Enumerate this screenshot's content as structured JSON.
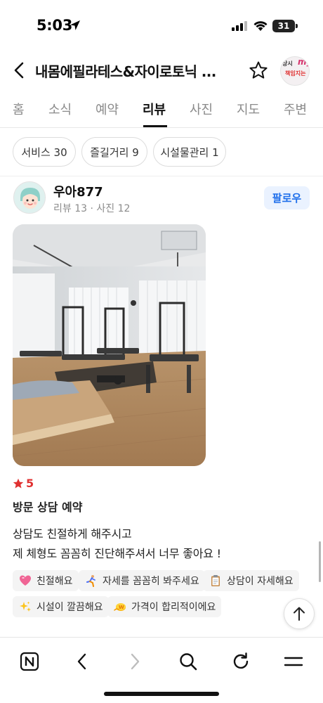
{
  "status_bar": {
    "time": "5:03",
    "battery": "31"
  },
  "header": {
    "title": "내몸에필라테스&자이로토닉 ...",
    "thumb_text_a": "상시",
    "thumb_text_b": "my",
    "thumb_text_c": "책임지는"
  },
  "tabs": [
    {
      "label": "홈"
    },
    {
      "label": "소식"
    },
    {
      "label": "예약"
    },
    {
      "label": "리뷰"
    },
    {
      "label": "사진"
    },
    {
      "label": "지도"
    },
    {
      "label": "주변"
    }
  ],
  "filters": [
    {
      "label": "서비스 30"
    },
    {
      "label": "즐길거리 9"
    },
    {
      "label": "시설물관리 1"
    }
  ],
  "review": {
    "author": "우아877",
    "meta": "리뷰 13 · 사진 12",
    "follow_label": "팔로우",
    "rating": "5",
    "title": "방문 상담 예약",
    "body_lines": [
      "상담도 친절하게 해주시고",
      "제 체형도 꼼꼼히 진단해주셔서 너무 좋아요 !"
    ],
    "keywords": [
      {
        "label": "친절해요",
        "icon": "heart-icon"
      },
      {
        "label": "자세를 꼼꼼히 봐주세요",
        "icon": "stretch-icon"
      },
      {
        "label": "상담이 자세해요",
        "icon": "clipboard-icon"
      },
      {
        "label": "시설이 깔끔해요",
        "icon": "sparkles-icon"
      },
      {
        "label": "가격이 합리적이에요",
        "icon": "coin-icon"
      }
    ]
  },
  "colors": {
    "accent_blue": "#1f6feb",
    "rating_red": "#e03131",
    "follow_bg": "#eaf2ff"
  }
}
